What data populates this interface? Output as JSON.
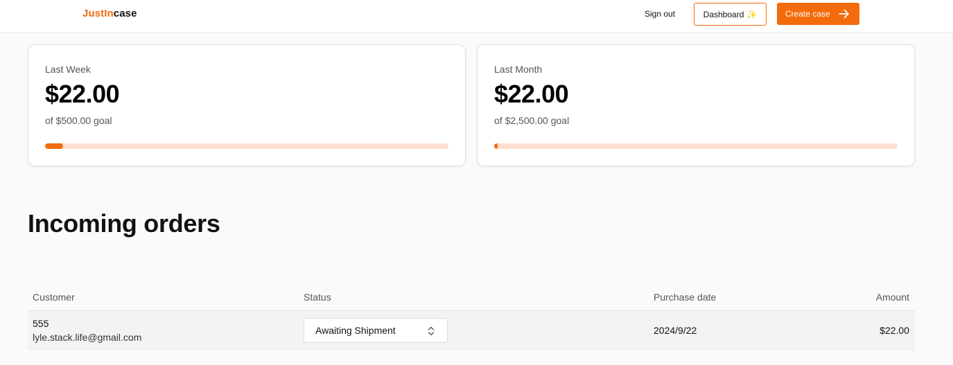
{
  "header": {
    "logo_part1": "JustIn",
    "logo_part2": "case",
    "sign_out": "Sign out",
    "dashboard_label": "Dashboard",
    "create_case_label": "Create case",
    "accent": "#f36b0c"
  },
  "stats": [
    {
      "period": "Last Week",
      "amount": "$22.00",
      "goal": "of $500.00 goal",
      "progress": 0.044
    },
    {
      "period": "Last Month",
      "amount": "$22.00",
      "goal": "of $2,500.00 goal",
      "progress": 0.0088
    }
  ],
  "orders": {
    "title": "Incoming orders",
    "columns": [
      "Customer",
      "Status",
      "Purchase date",
      "Amount"
    ],
    "rows": [
      {
        "customer_name": "555",
        "customer_email": "lyle.stack.life@gmail.com",
        "status": "Awaiting Shipment",
        "purchase_date": "2024/9/22",
        "amount": "$22.00"
      }
    ]
  }
}
